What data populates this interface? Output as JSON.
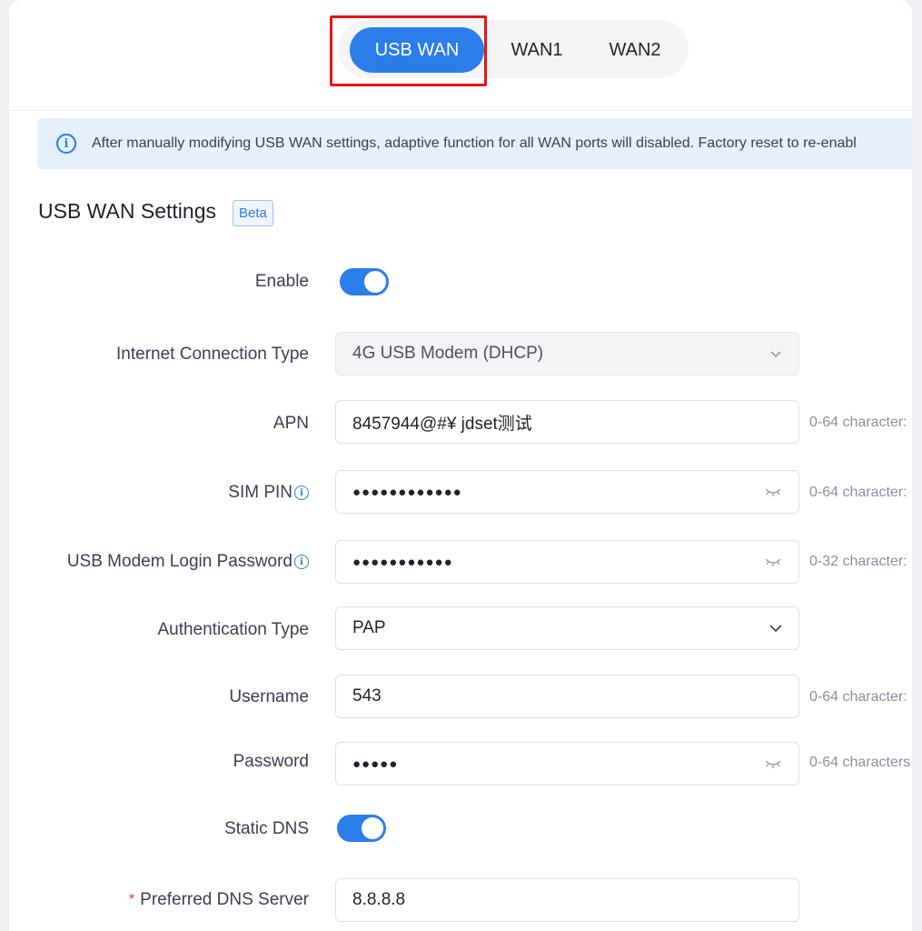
{
  "tabs": [
    {
      "label": "USB WAN",
      "active": true
    },
    {
      "label": "WAN1",
      "active": false
    },
    {
      "label": "WAN2",
      "active": false
    }
  ],
  "banner": {
    "icon": "info-icon",
    "text": "After manually modifying USB WAN settings, adaptive function for all WAN ports will disabled. Factory reset to re-enabl"
  },
  "section": {
    "title": "USB WAN Settings",
    "badge": "Beta"
  },
  "form": {
    "enable": {
      "label": "Enable",
      "checked": true
    },
    "connection_type": {
      "label": "Internet Connection Type",
      "value": "4G USB Modem (DHCP)",
      "disabled": true
    },
    "apn": {
      "label": "APN",
      "value": "8457944@#¥ jdset测试",
      "hint": "0-64 character:"
    },
    "sim_pin": {
      "label": "SIM PIN",
      "value": "●●●●●●●●●●●●",
      "hint": "0-64 character:"
    },
    "modem_password": {
      "label": "USB Modem Login Password",
      "value": "●●●●●●●●●●●",
      "hint": "0-32 character:"
    },
    "auth_type": {
      "label": "Authentication Type",
      "value": "PAP"
    },
    "username": {
      "label": "Username",
      "value": "543",
      "hint": "0-64 character:"
    },
    "password": {
      "label": "Password",
      "value": "●●●●●",
      "hint": "0-64 characters"
    },
    "static_dns": {
      "label": "Static DNS",
      "checked": true
    },
    "preferred_dns": {
      "label": "Preferred DNS Server",
      "required_mark": "*",
      "value": "8.8.8.8"
    }
  },
  "colors": {
    "accent": "#2b7de9",
    "highlight": "#e81616",
    "banner_bg": "#e6effc"
  }
}
